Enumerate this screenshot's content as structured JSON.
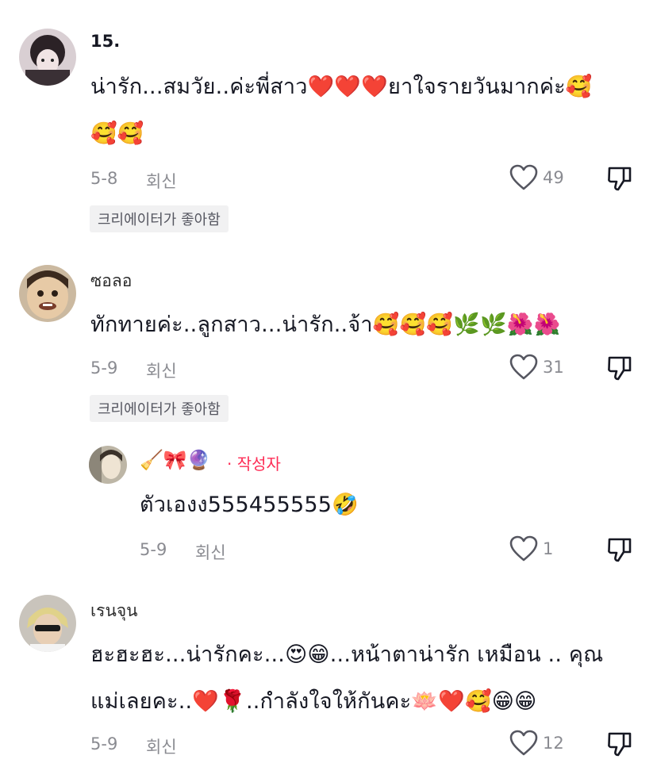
{
  "reply_label": "회신",
  "creator_liked_label": "크리에이터가 좋아함",
  "author_label": "· 작성자",
  "comments": [
    {
      "username": "15.",
      "text_line1": "น่ารัก...สมวัย..ค่ะพี่สาว❤️❤️❤️ยาใจรายวันมากค่ะ🥰",
      "text_line2": "🥰🥰",
      "date": "5-8",
      "likes": "49"
    },
    {
      "username": "ซอลอ",
      "text_line1": "ทักทายค่ะ..ลูกสาว...น่ารัก..จ้า🥰🥰🥰🌿🌿🌺🌺",
      "date": "5-9",
      "likes": "31"
    },
    {
      "username": "🧹🎀🔮",
      "text_line1": "ตัวเองง555455555🤣",
      "date": "5-9",
      "likes": "1"
    },
    {
      "username": "เรนจุน",
      "text_line1": "ฮะฮะฮะ...น่ารักคะ...😍😁...หน้าตาน่ารัก เหมือน .. คุณ",
      "text_line2": "แม่เลยคะ..❤️🌹..กำลังใจให้กันคะ🪷❤️🥰😁😁",
      "date": "5-9",
      "likes": "12"
    }
  ]
}
